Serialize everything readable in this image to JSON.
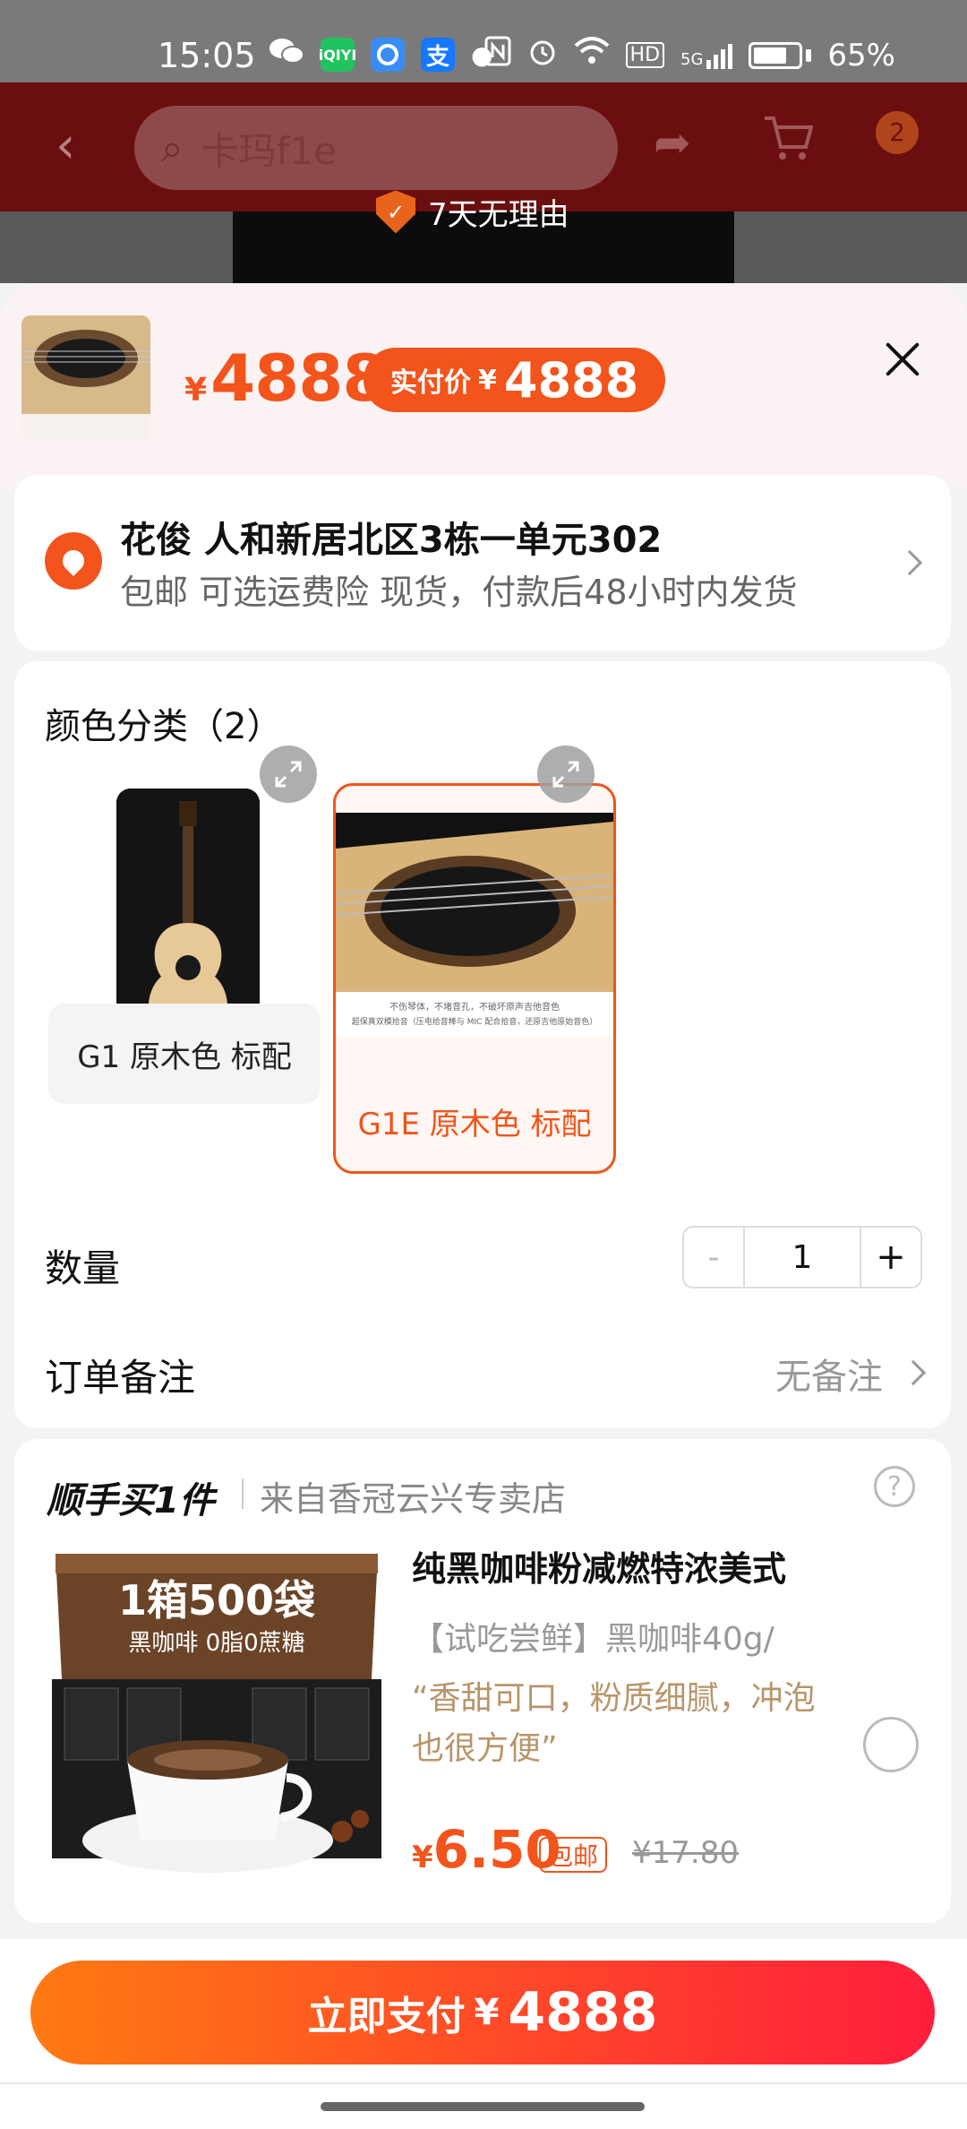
{
  "status_bar": {
    "time": "15:05",
    "app_icons": [
      "wechat-icon",
      "iqiyi-icon",
      "qq-browser-icon",
      "alipay-icon"
    ],
    "iqiyi_text": "iQIYI",
    "alipay_text": "支",
    "network": "5G",
    "battery": "65%"
  },
  "background_page": {
    "search_placeholder": "卡玛f1e",
    "cart_badge": "2",
    "promo": "7天无理由"
  },
  "sheet": {
    "price_symbol": "¥",
    "price": "4888",
    "paid_label": "实付价",
    "paid_symbol": "¥",
    "paid_price": "4888"
  },
  "address": {
    "name_line": "花俊 人和新居北区3栋一单元302",
    "sub_line": "包邮  可选运费险  现货，付款后48小时内发货"
  },
  "spec": {
    "title": "颜色分类（2）",
    "options": [
      {
        "label": "G1 原木色 标配",
        "selected": false
      },
      {
        "label": "G1E  原木色   标配",
        "selected": true
      }
    ],
    "option2_caption_1": "不伤琴体，不堵音孔，不破坏原声吉他音色",
    "option2_caption_2": "超保真双模拾音（压电拾音棒与 MIC 配合拾音，还原吉他原始音色）"
  },
  "quantity": {
    "label": "数量",
    "minus": "-",
    "value": "1",
    "plus": "+"
  },
  "note": {
    "label": "订单备注",
    "value": "无备注"
  },
  "addon": {
    "title": "顺手买1件",
    "store": "来自香冠云兴专卖店",
    "help": "?",
    "product_name": "纯黑咖啡粉减燃特浓美式",
    "product_tag": "【试吃尝鲜】黑咖啡40g/",
    "product_quote": "“香甜可口，粉质细腻，冲泡也很方便”",
    "image_headline": "1箱500袋",
    "image_subline": "黑咖啡  0脂0蔗糖",
    "price_symbol": "¥",
    "price": "6.50",
    "free_shipping": "包邮",
    "original_price": "¥17.80"
  },
  "footer": {
    "pay_label": "立即支付",
    "pay_symbol": "¥",
    "pay_price": "4888"
  },
  "colors": {
    "accent": "#f2541c",
    "pay_gradient_start": "#ff7a12",
    "pay_gradient_end": "#ff1e3c",
    "quote": "#b8956a"
  }
}
